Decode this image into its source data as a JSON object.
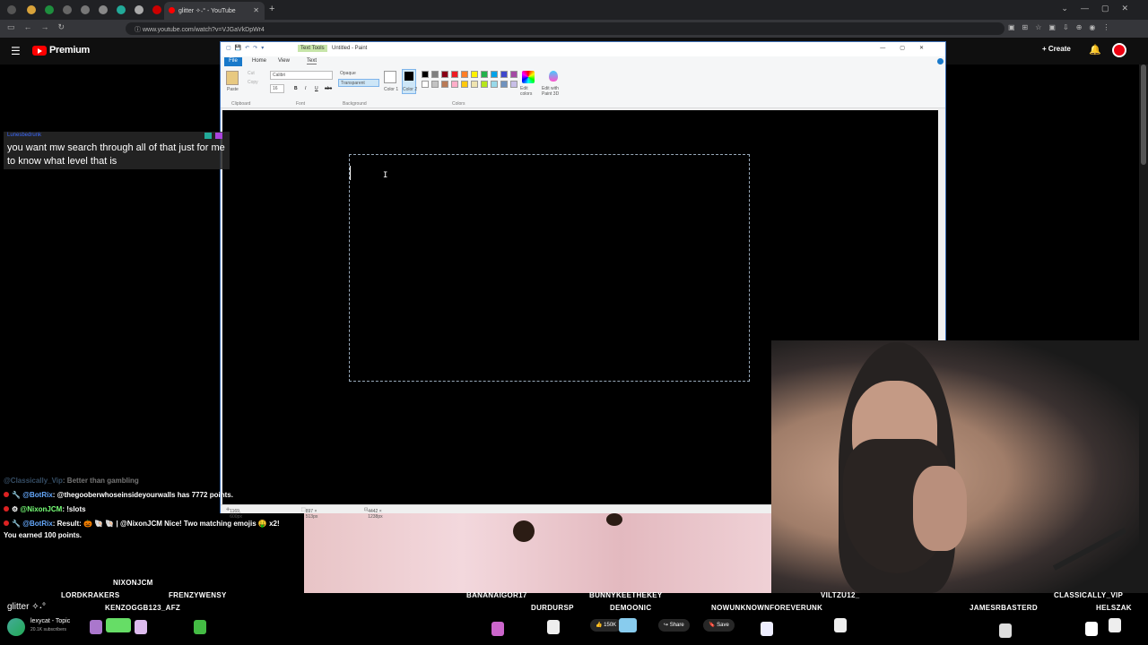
{
  "browser": {
    "tab_title": "glitter ✧˖° - YouTube",
    "url": "www.youtube.com/watch?v=VJGaVkDpWr4"
  },
  "youtube": {
    "brand": "Premium",
    "create_label": "Create"
  },
  "paint": {
    "window_title": "Untitled - Paint",
    "context_tab": "Text Tools",
    "tabs": [
      "File",
      "Home",
      "View",
      "Text"
    ],
    "ribbon": {
      "paste": "Paste",
      "cut": "Cut",
      "copy": "Copy",
      "font_name": "Calibri",
      "font_size": "16",
      "opaque": "Opaque",
      "transparent": "Transparent",
      "color1": "Color 1",
      "color2": "Color 2",
      "edit_colors": "Edit colors",
      "edit_paint3d": "Edit with Paint 3D",
      "groups": [
        "Clipboard",
        "Font",
        "Background",
        "Colors"
      ]
    },
    "palette": [
      "#000000",
      "#7f7f7f",
      "#880015",
      "#ed1c24",
      "#ff7f27",
      "#fff200",
      "#22b14c",
      "#00a2e8",
      "#3f48cc",
      "#a349a4",
      "#ffffff",
      "#c3c3c3",
      "#b97a57",
      "#ffaec9",
      "#ffc90e",
      "#efe4b0",
      "#b5e61d",
      "#99d9ea",
      "#7092be",
      "#c8bfe7"
    ],
    "status": {
      "cursor_pos": "1169, 600px",
      "selection_size": "897 × 513px",
      "canvas_size": "4442 × 1238px"
    }
  },
  "chat": {
    "pinned_name": "Lunesbedrunk",
    "pinned_text": "you want mw search through all of that just for me to know what level that is",
    "lines": [
      {
        "user": "@Classically_Vip",
        "text": ": Better than gambling",
        "faded": true
      },
      {
        "user": "@BotRix",
        "text": ": @thegooberwhoseinsideyourwalls has 7772 points."
      },
      {
        "user": "@NixonJCM",
        "text": ": !slots"
      },
      {
        "user": "@BotRix",
        "text": ": Result: 🎃 🐚 🐚 | @NixonJCM Nice! Two matching emojis 🤑 x2!"
      },
      {
        "user": "",
        "text": "You earned 100 points."
      }
    ]
  },
  "video": {
    "title": "glitter ✧˖°",
    "channel": "lexycat - Topic",
    "subscribers": "20.1K subscribers",
    "likes": "150K",
    "share": "Share",
    "save": "Save"
  },
  "stream_users": [
    "NIXONJCM",
    "LORDKRAKERS",
    "FRENZYWENSY",
    "KENZOGGB123_AFZ",
    "BANANAIGOR17",
    "DURDURSP",
    "BUNNYKEETHEKEY",
    "DEMOONIC",
    "NOWUNKNOWNFOREVERUNK",
    "VILTZU12_",
    "JAMESRBASTERD",
    "CLASSICALLY_VIP",
    "HELSZAK"
  ]
}
